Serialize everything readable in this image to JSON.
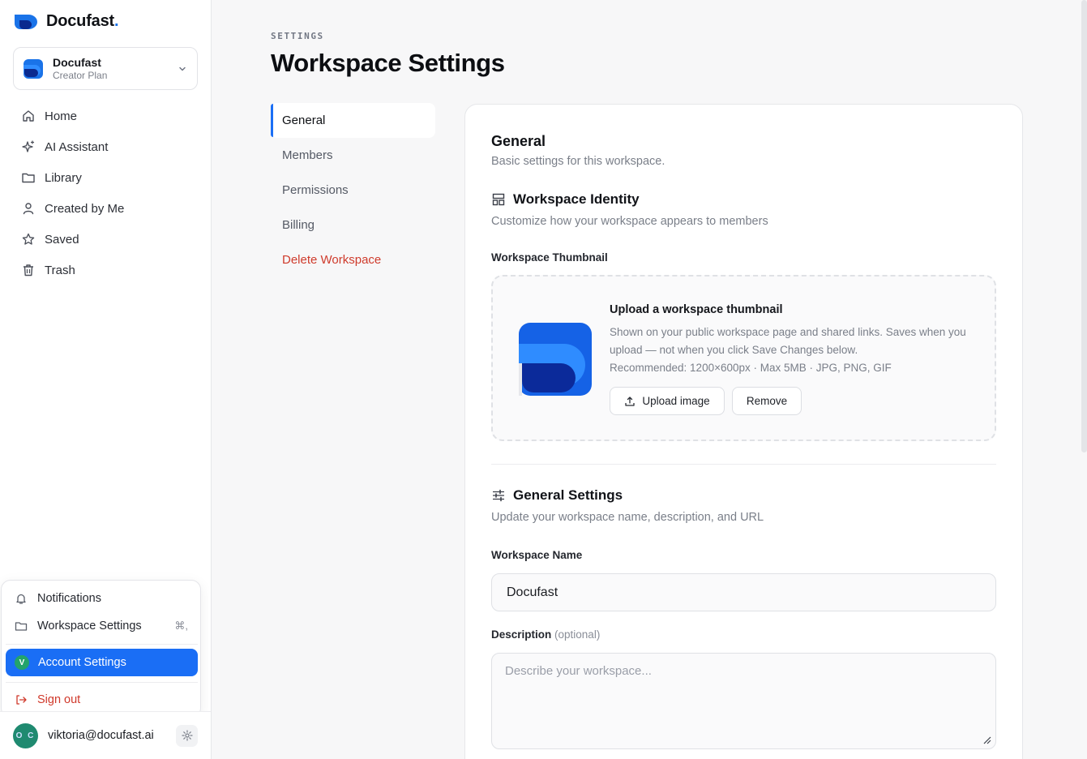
{
  "brand": {
    "name": "Docufast",
    "dot": "."
  },
  "workspace_switcher": {
    "name": "Docufast",
    "plan": "Creator Plan"
  },
  "nav": [
    {
      "label": "Home",
      "icon": "home-icon"
    },
    {
      "label": "AI Assistant",
      "icon": "sparkles-icon"
    },
    {
      "label": "Library",
      "icon": "folder-icon"
    },
    {
      "label": "Created by Me",
      "icon": "user-icon"
    },
    {
      "label": "Saved",
      "icon": "star-icon"
    },
    {
      "label": "Trash",
      "icon": "trash-icon"
    }
  ],
  "account_menu": {
    "notifications": "Notifications",
    "workspace_settings": "Workspace Settings",
    "workspace_settings_shortcut": "⌘,",
    "account_settings": "Account Settings",
    "account_avatar": "V",
    "sign_out": "Sign out"
  },
  "user": {
    "email": "viktoria@docufast.ai",
    "avatar_initials": "O C"
  },
  "header": {
    "eyebrow": "SETTINGS",
    "title": "Workspace Settings"
  },
  "subnav": {
    "items": [
      "General",
      "Members",
      "Permissions",
      "Billing"
    ],
    "danger": "Delete Workspace",
    "active": "General"
  },
  "card": {
    "title": "General",
    "subtitle": "Basic settings for this workspace.",
    "identity": {
      "title": "Workspace Identity",
      "subtitle": "Customize how your workspace appears to members",
      "thumbnail_label": "Workspace Thumbnail",
      "upload_title": "Upload a workspace thumbnail",
      "upload_desc": "Shown on your public workspace page and shared links. Saves when you upload — not when you click Save Changes below.",
      "upload_reco": "Recommended: 1200×600px · Max 5MB · JPG, PNG, GIF",
      "upload_button": "Upload image",
      "remove_button": "Remove"
    },
    "general_settings": {
      "title": "General Settings",
      "subtitle": "Update your workspace name, description, and URL",
      "name_label": "Workspace Name",
      "name_value": "Docufast",
      "desc_label": "Description",
      "desc_optional": "(optional)",
      "desc_placeholder": "Describe your workspace..."
    }
  },
  "colors": {
    "accent": "#1a6ef5",
    "danger": "#cf3b2c",
    "brand_blue": "#1a73e8"
  }
}
